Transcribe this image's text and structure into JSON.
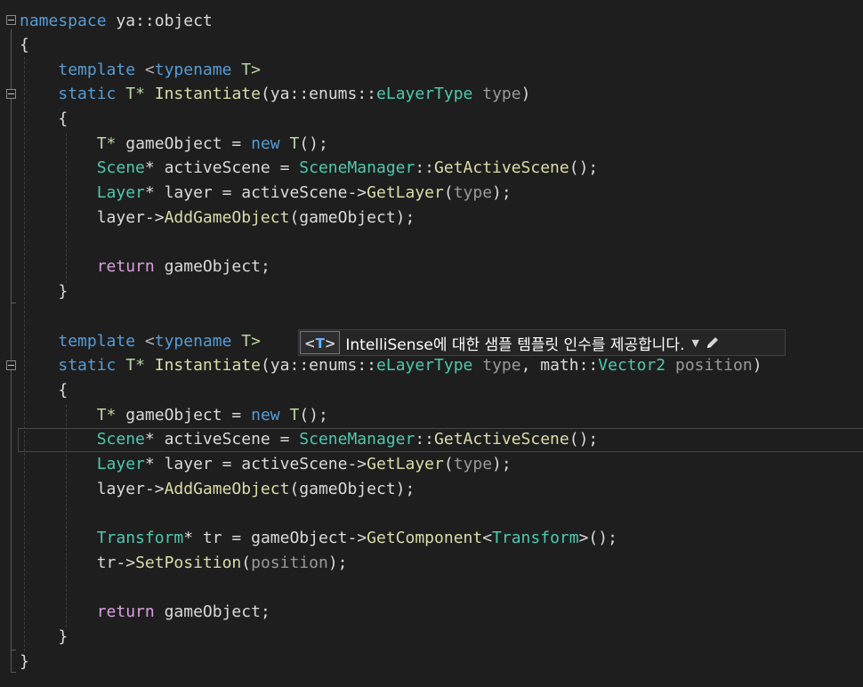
{
  "editor": {
    "tooltip": {
      "badge_open": "<",
      "badge_t": "T",
      "badge_close": ">",
      "text": "IntelliSense에 대한 샘플 템플릿 인수를 제공합니다.",
      "dropdown_icon": "triangle-down-icon",
      "edit_icon": "pencil-icon"
    },
    "tokens": {
      "namespace": "namespace",
      "ns_name": " ya::object",
      "lbrace": "{",
      "rbrace": "}",
      "template": "template",
      "typename_open": " <",
      "typename": "typename",
      "T": "T",
      "T_close": " T>",
      "static": "static",
      "Tstar": " T*",
      "Instantiate": "Instantiate",
      "ya_enums": "(ya::enums::",
      "eLayerType": "eLayerType",
      "type_param": " type",
      "close_paren": ")",
      "comma_math": ", math::",
      "Vector2": "Vector2",
      "position_param": " position",
      "Tstar2": "T*",
      "gameObject_decl": " gameObject = ",
      "new": "new",
      "T_ctor": " T",
      "ctor_end": "();",
      "Scene": "Scene",
      "activeScene_decl": "* activeScene = ",
      "SceneManager": "SceneManager",
      "colons": "::",
      "GetActiveScene": "GetActiveScene",
      "call_end": "();",
      "Layer": "Layer",
      "layer_decl": "* layer = activeScene->",
      "GetLayer": "GetLayer",
      "open": "(",
      "type_arg": "type",
      "close_semi": ");",
      "layer_arrow": "layer->",
      "AddGameObject": "AddGameObject",
      "gameObject_arg": "gameObject",
      "return": "return",
      "ret_val": " gameObject;",
      "Transform": "Transform",
      "tr_decl": "* tr = gameObject->",
      "GetComponent": "GetComponent",
      "lt": "<",
      "gt_call": ">();",
      "tr_arrow": "tr->",
      "SetPosition": "SetPosition",
      "position_arg": "position"
    }
  }
}
